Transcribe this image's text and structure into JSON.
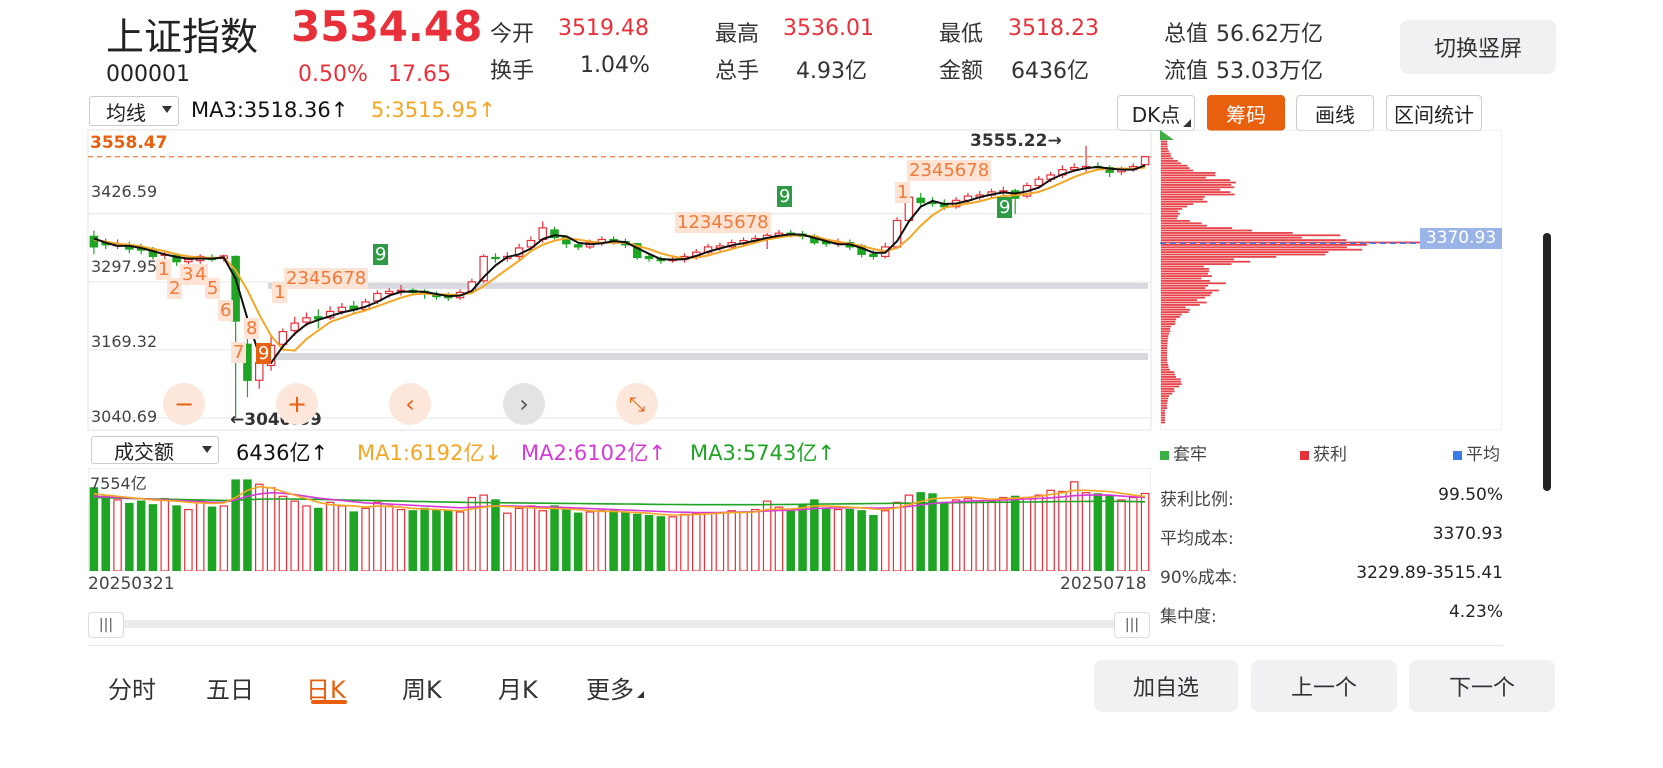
{
  "header": {
    "name": "上证指数",
    "code": "000001",
    "price": "3534.48",
    "change_pct": "0.50%",
    "change_abs": "17.65",
    "open_label": "今开",
    "open_val": "3519.48",
    "high_label": "最高",
    "high_val": "3536.01",
    "low_label": "最低",
    "low_val": "3518.23",
    "total_value_label": "总值",
    "total_value_val": "56.62万亿",
    "turnover_label": "换手",
    "turnover_val": "1.04%",
    "volume_label": "总手",
    "volume_val": "4.93亿",
    "amount_label": "金额",
    "amount_val": "6436亿",
    "float_value_label": "流值",
    "float_value_val": "53.03万亿",
    "switch_button": "切换竖屏"
  },
  "main_chart": {
    "indicator_select": "均线",
    "ma3_text": "MA3:3518.36",
    "ma5_text": "5:3515.95",
    "dk_button": "DK点",
    "chips_button": "筹码",
    "draw_button": "画线",
    "range_stats_button": "区间统计",
    "y_ticks": [
      "3426.59",
      "3297.95",
      "3169.32",
      "3040.69"
    ],
    "top_overlay_label": "3558.47",
    "top_overlay_label2": "3555.22",
    "high_annotation": "3555.22",
    "low_annotation": "3040.69",
    "avg_cost_badge": "3370.93",
    "controls": {
      "zoom_out": "−",
      "zoom_in": "+",
      "prev": "‹",
      "next": "›",
      "collapse": "⤡"
    }
  },
  "volume_chart": {
    "indicator_select": "成交额",
    "vol_text": "6436亿",
    "ma1_text": "MA1:6192亿",
    "ma2_text": "MA2:6102亿",
    "ma3_text": "MA3:5743亿",
    "y_top": "7554亿",
    "date_start": "20250321",
    "date_end": "20250718"
  },
  "chips_panel": {
    "legend_trapped": "套牢",
    "legend_profit": "获利",
    "legend_avg": "平均",
    "rows": [
      {
        "label": "获利比例:",
        "value": "99.50%"
      },
      {
        "label": "平均成本:",
        "value": "3370.93"
      },
      {
        "label": "90%成本:",
        "value": "3229.89-3515.41"
      },
      {
        "label": "集中度:",
        "value": "4.23%"
      }
    ]
  },
  "bottom_tabs": [
    "分时",
    "五日",
    "日K",
    "周K",
    "月K",
    "更多"
  ],
  "bottom_buttons": {
    "add_watch": "加自选",
    "prev": "上一个",
    "next": "下一个"
  },
  "colors": {
    "up": "#e8303a",
    "down": "#1fa424",
    "ma3": "#111111",
    "ma5": "#f5a623",
    "accent": "#e8600e",
    "ma2": "#d63ad6"
  },
  "chart_data": {
    "type": "candlestick",
    "x_start": "20250321",
    "x_end": "20250718",
    "ylim": [
      3040.69,
      3558.47
    ],
    "y_ticks": [
      3426.59,
      3297.95,
      3169.32,
      3040.69
    ],
    "candles": [
      [
        3384,
        3364,
        3395,
        3350
      ],
      [
        3372,
        3368,
        3380,
        3360
      ],
      [
        3366,
        3370,
        3378,
        3360
      ],
      [
        3368,
        3360,
        3374,
        3352
      ],
      [
        3362,
        3358,
        3370,
        3350
      ],
      [
        3360,
        3346,
        3364,
        3340
      ],
      [
        3348,
        3350,
        3356,
        3336
      ],
      [
        3348,
        3336,
        3352,
        3328
      ],
      [
        3336,
        3340,
        3344,
        3330
      ],
      [
        3338,
        3346,
        3350,
        3332
      ],
      [
        3344,
        3340,
        3350,
        3336
      ],
      [
        3342,
        3347,
        3350,
        3336
      ],
      [
        3346,
        3224,
        3348,
        3040.69
      ],
      [
        3180,
        3112,
        3200,
        3080
      ],
      [
        3112,
        3145,
        3160,
        3096
      ],
      [
        3140,
        3178,
        3198,
        3130
      ],
      [
        3180,
        3204,
        3210,
        3170
      ],
      [
        3206,
        3220,
        3232,
        3196
      ],
      [
        3222,
        3230,
        3240,
        3214
      ],
      [
        3232,
        3228,
        3246,
        3210
      ],
      [
        3230,
        3242,
        3252,
        3226
      ],
      [
        3242,
        3250,
        3258,
        3236
      ],
      [
        3252,
        3245,
        3262,
        3240
      ],
      [
        3246,
        3260,
        3266,
        3242
      ],
      [
        3262,
        3276,
        3282,
        3256
      ],
      [
        3276,
        3280,
        3286,
        3268
      ],
      [
        3280,
        3282,
        3292,
        3272
      ],
      [
        3282,
        3278,
        3286,
        3272
      ],
      [
        3280,
        3276,
        3284,
        3266
      ],
      [
        3274,
        3270,
        3280,
        3264
      ],
      [
        3272,
        3268,
        3278,
        3262
      ],
      [
        3268,
        3278,
        3284,
        3264
      ],
      [
        3280,
        3298,
        3304,
        3276
      ],
      [
        3300,
        3346,
        3350,
        3296
      ],
      [
        3344,
        3342,
        3352,
        3334
      ],
      [
        3342,
        3346,
        3354,
        3336
      ],
      [
        3346,
        3362,
        3370,
        3340
      ],
      [
        3364,
        3376,
        3384,
        3358
      ],
      [
        3378,
        3400,
        3412,
        3372
      ],
      [
        3396,
        3382,
        3402,
        3378
      ],
      [
        3382,
        3370,
        3386,
        3362
      ],
      [
        3368,
        3364,
        3374,
        3358
      ],
      [
        3364,
        3372,
        3378,
        3360
      ],
      [
        3372,
        3378,
        3384,
        3366
      ],
      [
        3378,
        3374,
        3384,
        3368
      ],
      [
        3374,
        3368,
        3380,
        3362
      ],
      [
        3370,
        3344,
        3372,
        3340
      ],
      [
        3346,
        3342,
        3350,
        3336
      ],
      [
        3342,
        3338,
        3346,
        3332
      ],
      [
        3338,
        3340,
        3348,
        3334
      ],
      [
        3340,
        3346,
        3352,
        3334
      ],
      [
        3344,
        3354,
        3360,
        3340
      ],
      [
        3354,
        3364,
        3370,
        3350
      ],
      [
        3362,
        3366,
        3372,
        3356
      ],
      [
        3364,
        3372,
        3378,
        3360
      ],
      [
        3370,
        3376,
        3382,
        3364
      ],
      [
        3374,
        3380,
        3386,
        3370
      ],
      [
        3380,
        3386,
        3392,
        3360
      ],
      [
        3386,
        3390,
        3396,
        3380
      ],
      [
        3390,
        3388,
        3396,
        3382
      ],
      [
        3388,
        3384,
        3394,
        3378
      ],
      [
        3384,
        3372,
        3388,
        3368
      ],
      [
        3374,
        3370,
        3380,
        3364
      ],
      [
        3370,
        3372,
        3380,
        3364
      ],
      [
        3372,
        3364,
        3378,
        3358
      ],
      [
        3366,
        3350,
        3370,
        3344
      ],
      [
        3350,
        3346,
        3358,
        3340
      ],
      [
        3346,
        3364,
        3372,
        3342
      ],
      [
        3364,
        3414,
        3420,
        3360
      ],
      [
        3414,
        3458,
        3462,
        3410
      ],
      [
        3456,
        3448,
        3466,
        3442
      ],
      [
        3448,
        3446,
        3458,
        3440
      ],
      [
        3446,
        3440,
        3454,
        3434
      ],
      [
        3440,
        3452,
        3458,
        3436
      ],
      [
        3452,
        3460,
        3466,
        3446
      ],
      [
        3458,
        3462,
        3470,
        3452
      ],
      [
        3462,
        3468,
        3474,
        3456
      ],
      [
        3468,
        3470,
        3478,
        3462
      ],
      [
        3470,
        3456,
        3474,
        3426
      ],
      [
        3460,
        3480,
        3486,
        3456
      ],
      [
        3480,
        3492,
        3498,
        3474
      ],
      [
        3492,
        3500,
        3506,
        3486
      ],
      [
        3500,
        3510,
        3518,
        3494
      ],
      [
        3510,
        3514,
        3522,
        3506
      ],
      [
        3512,
        3516,
        3555.22,
        3506
      ],
      [
        3516,
        3514,
        3524,
        3508
      ],
      [
        3514,
        3505,
        3518,
        3496
      ],
      [
        3506,
        3510,
        3516,
        3500
      ],
      [
        3510,
        3516,
        3522,
        3506
      ],
      [
        3519.48,
        3534.48,
        3536.01,
        3518.23
      ]
    ],
    "ma3": [
      3380,
      3372,
      3366,
      3366,
      3362,
      3356,
      3350,
      3345,
      3342,
      3342,
      3342,
      3344,
      3304,
      3228,
      3160,
      3145,
      3176,
      3200,
      3218,
      3226,
      3233,
      3240,
      3245,
      3251,
      3260,
      3272,
      3279,
      3280,
      3279,
      3275,
      3271,
      3272,
      3281,
      3307,
      3329,
      3345,
      3350,
      3361,
      3379,
      3386,
      3384,
      3372,
      3369,
      3371,
      3375,
      3373,
      3362,
      3351,
      3341,
      3340,
      3341,
      3347,
      3355,
      3361,
      3367,
      3371,
      3376,
      3381,
      3385,
      3388,
      3387,
      3381,
      3375,
      3369,
      3369,
      3362,
      3353,
      3353,
      3375,
      3412,
      3440,
      3451,
      3445,
      3446,
      3451,
      3458,
      3463,
      3467,
      3465,
      3469,
      3476,
      3491,
      3501,
      3508,
      3513,
      3515,
      3512,
      3510,
      3510,
      3518
    ],
    "ma5": [
      3378,
      3374,
      3370,
      3368,
      3365,
      3360,
      3356,
      3350,
      3346,
      3344,
      3343,
      3344,
      3320,
      3282,
      3236,
      3196,
      3170,
      3168,
      3190,
      3206,
      3222,
      3230,
      3238,
      3244,
      3252,
      3260,
      3268,
      3274,
      3276,
      3274,
      3274,
      3273,
      3277,
      3290,
      3306,
      3322,
      3338,
      3356,
      3368,
      3376,
      3380,
      3378,
      3374,
      3372,
      3372,
      3372,
      3366,
      3360,
      3352,
      3346,
      3342,
      3344,
      3348,
      3354,
      3360,
      3366,
      3372,
      3378,
      3382,
      3385,
      3386,
      3384,
      3378,
      3374,
      3370,
      3366,
      3360,
      3356,
      3362,
      3380,
      3404,
      3424,
      3438,
      3442,
      3446,
      3450,
      3456,
      3460,
      3462,
      3464,
      3468,
      3476,
      3486,
      3496,
      3504,
      3510,
      3512,
      3512,
      3512,
      3514
    ],
    "volume_yi": [
      6900,
      6200,
      5900,
      5600,
      5800,
      5500,
      6000,
      5400,
      5100,
      5800,
      5300,
      5400,
      7554,
      7554,
      7200,
      6900,
      6200,
      5800,
      5400,
      5200,
      5700,
      5400,
      4900,
      5200,
      5700,
      5400,
      5100,
      5000,
      5200,
      5100,
      5000,
      4900,
      6100,
      6300,
      5900,
      4800,
      5200,
      5400,
      5000,
      5400,
      5100,
      4800,
      4900,
      5000,
      5000,
      4900,
      4700,
      4600,
      4500,
      4500,
      4700,
      4800,
      4800,
      4800,
      5000,
      4900,
      5100,
      5800,
      5300,
      5000,
      5500,
      5900,
      5200,
      5100,
      5100,
      5000,
      4600,
      5000,
      5700,
      6300,
      6500,
      6400,
      5700,
      5900,
      6000,
      5800,
      5800,
      6100,
      6200,
      6100,
      6300,
      6700,
      6600,
      7400,
      6500,
      6400,
      6300,
      5900,
      6100,
      6436
    ],
    "volume_ma1": [
      6400,
      6300,
      6200,
      6100,
      6000,
      5900,
      5850,
      5800,
      5700,
      5650,
      5600,
      5650,
      6100,
      6700,
      7000,
      6900,
      6600,
      6300,
      6000,
      5700,
      5500,
      5450,
      5400,
      5300,
      5400,
      5350,
      5300,
      5200,
      5150,
      5100,
      5050,
      5000,
      5150,
      5300,
      5400,
      5350,
      5300,
      5250,
      5200,
      5200,
      5150,
      5100,
      5000,
      4950,
      4950,
      4900,
      4850,
      4800,
      4700,
      4650,
      4650,
      4700,
      4750,
      4800,
      4850,
      4850,
      4900,
      5100,
      5150,
      5150,
      5250,
      5400,
      5400,
      5350,
      5300,
      5250,
      5150,
      5100,
      5250,
      5500,
      5750,
      6000,
      6050,
      6100,
      6150,
      6050,
      5950,
      6000,
      6050,
      6100,
      6200,
      6350,
      6500,
      6700,
      6700,
      6650,
      6600,
      6450,
      6300,
      6192
    ],
    "volume_ma2": [
      6200,
      6150,
      6100,
      6050,
      6000,
      5950,
      5900,
      5850,
      5800,
      5750,
      5700,
      5700,
      5900,
      6200,
      6400,
      6500,
      6450,
      6350,
      6200,
      6050,
      5950,
      5850,
      5750,
      5650,
      5600,
      5550,
      5500,
      5450,
      5400,
      5350,
      5300,
      5250,
      5300,
      5350,
      5400,
      5400,
      5380,
      5350,
      5320,
      5300,
      5260,
      5220,
      5180,
      5140,
      5100,
      5060,
      5020,
      4980,
      4940,
      4900,
      4880,
      4860,
      4860,
      4860,
      4880,
      4900,
      4920,
      4980,
      5020,
      5050,
      5100,
      5180,
      5220,
      5240,
      5250,
      5250,
      5230,
      5220,
      5260,
      5360,
      5480,
      5600,
      5680,
      5740,
      5800,
      5840,
      5860,
      5900,
      5940,
      5980,
      6020,
      6080,
      6150,
      6250,
      6300,
      6320,
      6300,
      6220,
      6160,
      6102
    ],
    "volume_ma3": [
      6100,
      6080,
      6050,
      6020,
      6000,
      5980,
      5960,
      5940,
      5920,
      5900,
      5880,
      5860,
      5880,
      5920,
      5960,
      5980,
      5980,
      5970,
      5960,
      5940,
      5920,
      5900,
      5880,
      5860,
      5840,
      5820,
      5800,
      5780,
      5760,
      5740,
      5720,
      5700,
      5690,
      5680,
      5670,
      5660,
      5650,
      5640,
      5630,
      5620,
      5610,
      5600,
      5590,
      5580,
      5570,
      5560,
      5550,
      5540,
      5530,
      5520,
      5510,
      5500,
      5500,
      5500,
      5500,
      5500,
      5500,
      5510,
      5520,
      5530,
      5540,
      5550,
      5560,
      5570,
      5580,
      5590,
      5600,
      5610,
      5620,
      5630,
      5640,
      5650,
      5660,
      5670,
      5680,
      5690,
      5700,
      5710,
      5720,
      5730,
      5740,
      5750,
      5760,
      5770,
      5780,
      5790,
      5790,
      5780,
      5760,
      5743
    ]
  }
}
